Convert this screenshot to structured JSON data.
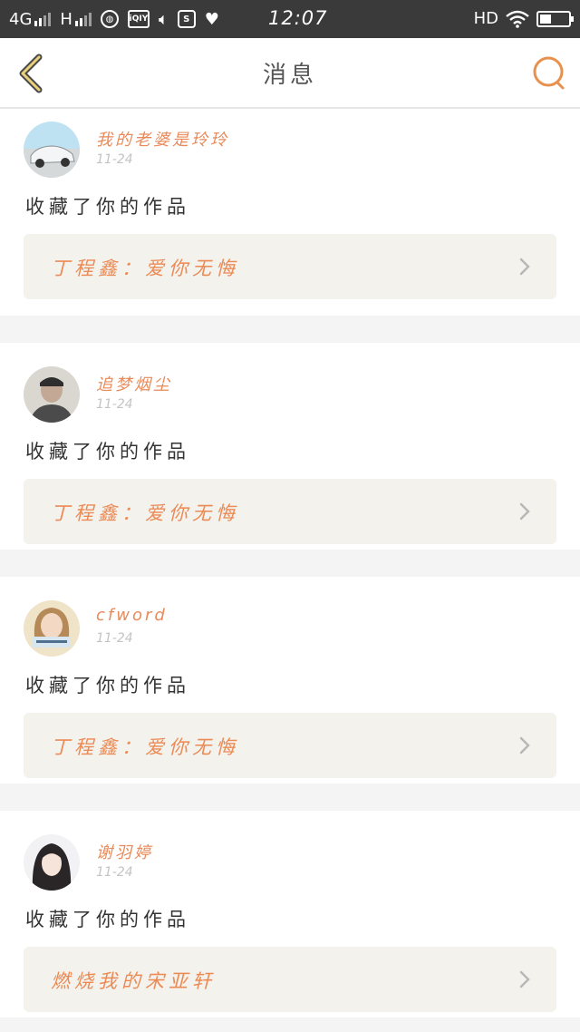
{
  "status_bar": {
    "network": "4G",
    "network2": "H",
    "time": "12:07",
    "hd": "HD",
    "icons": [
      "browser-icon",
      "iqiyi-icon",
      "mute-icon",
      "s-icon",
      "shield-icon",
      "wifi-icon",
      "battery-icon"
    ]
  },
  "header": {
    "title": "消息",
    "back_icon": "chevron-left-icon",
    "search_icon": "search-icon",
    "accent": "#e8914f"
  },
  "messages": [
    {
      "name": "我的老婆是玲玲",
      "date": "11-24",
      "action": "收藏了你的作品",
      "work": "丁程鑫：爱你无悔",
      "avatar": "car"
    },
    {
      "name": "追梦烟尘",
      "date": "11-24",
      "action": "收藏了你的作品",
      "work": "丁程鑫：爱你无悔",
      "avatar": "man"
    },
    {
      "name": "cfword",
      "date": "11-24",
      "action": "收藏了你的作品",
      "work": "丁程鑫：爱你无悔",
      "avatar": "girl"
    },
    {
      "name": "谢羽婷",
      "date": "11-24",
      "action": "收藏了你的作品",
      "work": "燃烧我的宋亚轩",
      "avatar": "woman"
    }
  ]
}
